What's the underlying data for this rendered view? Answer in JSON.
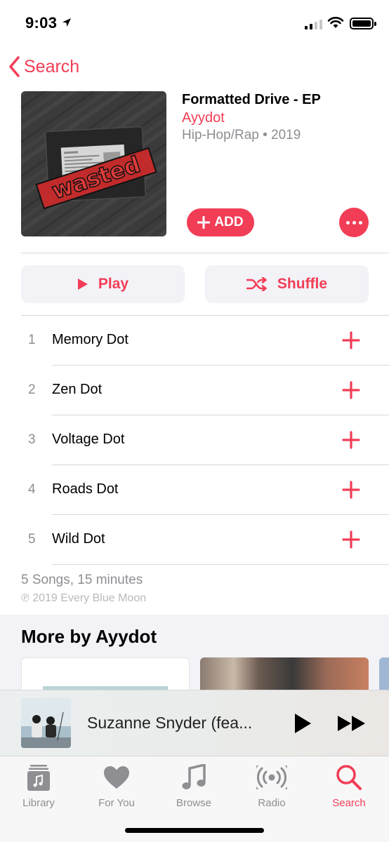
{
  "status_bar": {
    "time": "9:03"
  },
  "nav": {
    "back_label": "Search"
  },
  "album": {
    "title": "Formatted Drive - EP",
    "artist": "Ayydot",
    "genre_year": "Hip-Hop/Rap • 2019",
    "cover_text": "wasted",
    "add_label": "ADD"
  },
  "actions": {
    "play_label": "Play",
    "shuffle_label": "Shuffle"
  },
  "tracks": [
    {
      "number": "1",
      "title": "Memory Dot"
    },
    {
      "number": "2",
      "title": "Zen Dot"
    },
    {
      "number": "3",
      "title": "Voltage Dot"
    },
    {
      "number": "4",
      "title": "Roads Dot"
    },
    {
      "number": "5",
      "title": "Wild Dot"
    }
  ],
  "summary": "5 Songs, 15 minutes",
  "copyright": "℗ 2019 Every Blue Moon",
  "more_by": {
    "title": "More by Ayydot"
  },
  "now_playing": {
    "title": "Suzanne Snyder (fea..."
  },
  "tab_bar": {
    "tabs": [
      {
        "label": "Library",
        "icon": "library-icon"
      },
      {
        "label": "For You",
        "icon": "heart-icon"
      },
      {
        "label": "Browse",
        "icon": "music-note-icon"
      },
      {
        "label": "Radio",
        "icon": "radio-icon"
      },
      {
        "label": "Search",
        "icon": "search-icon"
      }
    ],
    "active": "Search"
  },
  "colors": {
    "accent": "#f23d56",
    "secondary_text": "#8e8e93",
    "button_bg": "#f2f2f7"
  }
}
